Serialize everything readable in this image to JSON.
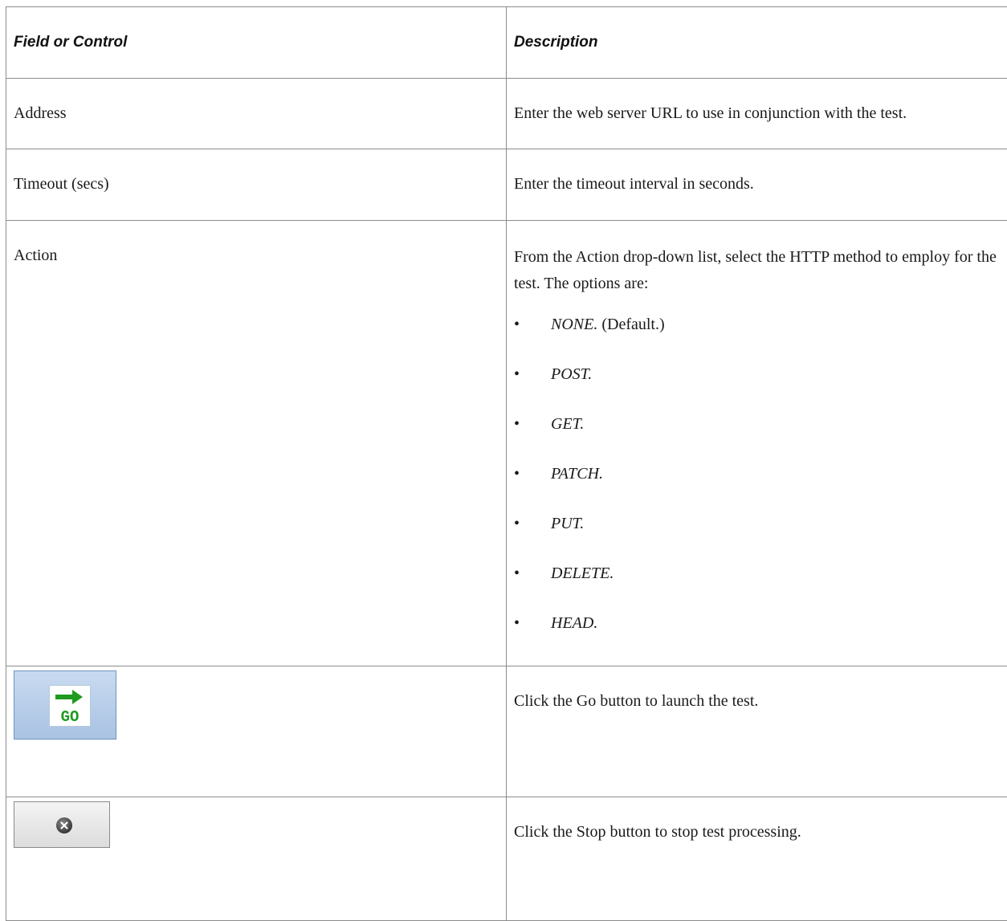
{
  "table": {
    "header": {
      "col1": "Field or Control",
      "col2": "Description"
    },
    "rows": [
      {
        "field": "Address",
        "description": "Enter the web server URL to use in conjunction with the test."
      },
      {
        "field": "Timeout (secs)",
        "description": "Enter the timeout interval in seconds."
      },
      {
        "field": "Action",
        "description": "From the Action drop-down list, select the HTTP method to employ for the test. The options are:",
        "options": [
          {
            "name": "NONE.",
            "note": "(Default.)"
          },
          {
            "name": "POST."
          },
          {
            "name": "GET."
          },
          {
            "name": "PATCH."
          },
          {
            "name": "PUT."
          },
          {
            "name": "DELETE."
          },
          {
            "name": "HEAD."
          }
        ]
      },
      {
        "field_icon": "go-button-icon",
        "description": "Click the Go button to launch the test."
      },
      {
        "field_icon": "stop-button-icon",
        "description": "Click the Stop button to stop test processing."
      }
    ]
  },
  "colors": {
    "border": "#8c8c8c",
    "go_green": "#1f9a1f",
    "go_button_blue": "#a9c3e3",
    "stop_icon": "#4a4a4a"
  }
}
